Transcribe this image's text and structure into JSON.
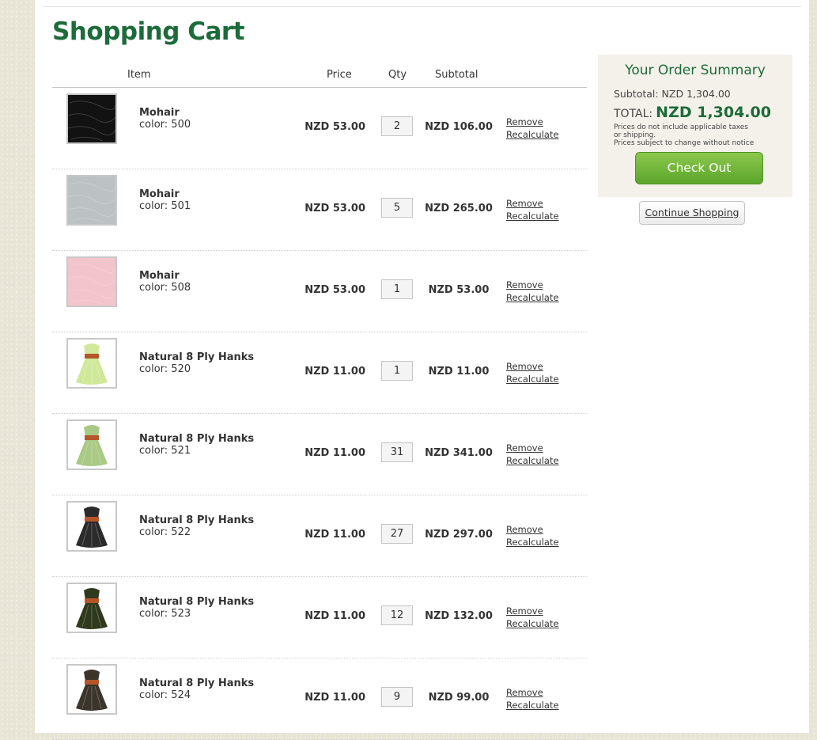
{
  "page_title": "Shopping Cart",
  "table_headers": {
    "item": "Item",
    "price": "Price",
    "qty": "Qty",
    "subtotal": "Subtotal"
  },
  "items": [
    {
      "name": "Mohair",
      "color": "color: 500",
      "price": "NZD 53.00",
      "qty": "2",
      "subtotal": "NZD 106.00",
      "remove": "Remove",
      "recalculate": "Recalculate",
      "thumb": "mohair",
      "swatch": "#121212"
    },
    {
      "name": "Mohair",
      "color": "color: 501",
      "price": "NZD 53.00",
      "qty": "5",
      "subtotal": "NZD 265.00",
      "remove": "Remove",
      "recalculate": "Recalculate",
      "thumb": "mohair",
      "swatch": "#bcc2c4"
    },
    {
      "name": "Mohair",
      "color": "color: 508",
      "price": "NZD 53.00",
      "qty": "1",
      "subtotal": "NZD 53.00",
      "remove": "Remove",
      "recalculate": "Recalculate",
      "thumb": "mohair",
      "swatch": "#f2c4cb"
    },
    {
      "name": "Natural 8 Ply Hanks",
      "color": "color: 520",
      "price": "NZD 11.00",
      "qty": "1",
      "subtotal": "NZD 11.00",
      "remove": "Remove",
      "recalculate": "Recalculate",
      "thumb": "hank",
      "swatch": "#cfe89a"
    },
    {
      "name": "Natural 8 Ply Hanks",
      "color": "color: 521",
      "price": "NZD 11.00",
      "qty": "31",
      "subtotal": "NZD 341.00",
      "remove": "Remove",
      "recalculate": "Recalculate",
      "thumb": "hank",
      "swatch": "#a9c985"
    },
    {
      "name": "Natural 8 Ply Hanks",
      "color": "color: 522",
      "price": "NZD 11.00",
      "qty": "27",
      "subtotal": "NZD 297.00",
      "remove": "Remove",
      "recalculate": "Recalculate",
      "thumb": "hank",
      "swatch": "#2b2b2b"
    },
    {
      "name": "Natural 8 Ply Hanks",
      "color": "color: 523",
      "price": "NZD 11.00",
      "qty": "12",
      "subtotal": "NZD 132.00",
      "remove": "Remove",
      "recalculate": "Recalculate",
      "thumb": "hank",
      "swatch": "#2f3a1d"
    },
    {
      "name": "Natural 8 Ply Hanks",
      "color": "color: 524",
      "price": "NZD 11.00",
      "qty": "9",
      "subtotal": "NZD 99.00",
      "remove": "Remove",
      "recalculate": "Recalculate",
      "thumb": "hank",
      "swatch": "#3b342b"
    }
  ],
  "summary": {
    "title": "Your Order Summary",
    "subtotal": "Subtotal: NZD 1,304.00",
    "total_label": "TOTAL:",
    "total_value": "NZD 1,304.00",
    "note1": "Prices do not include applicable taxes or shipping.",
    "note2": "Prices subject to change without notice",
    "checkout_label": "Check Out"
  },
  "continue_label": "Continue Shopping",
  "colors": {
    "brand_green": "#1d6b3a",
    "checkout_green": "#5aa52a"
  }
}
